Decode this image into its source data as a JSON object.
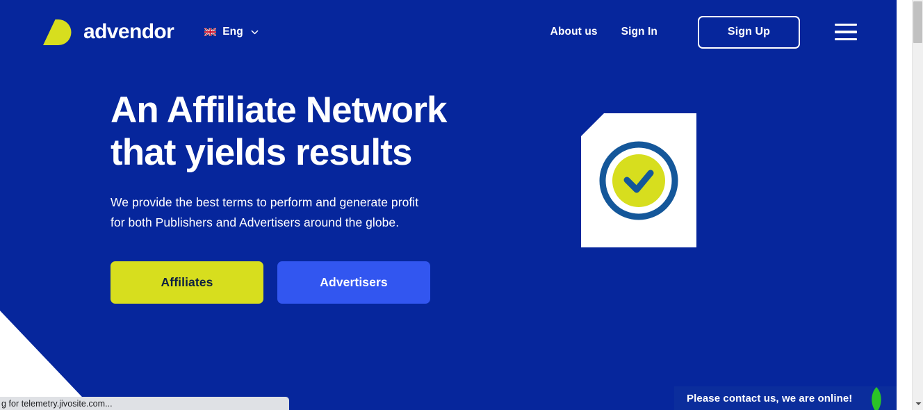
{
  "theme": {
    "page_bg": "#06269c",
    "accent_yellow": "#d7de1e",
    "accent_blue": "#3256f0",
    "ring_blue": "#14579a",
    "text_on_yellow": "#0d2040",
    "white": "#ffffff",
    "chat_bg": "#0b2d9c",
    "chat_leaf_green": "#2bc328"
  },
  "header": {
    "brand_name": "advendor",
    "logo_icon": "advendor-logo-icon",
    "language": {
      "flag_icon": "uk-flag-icon",
      "label": "Eng",
      "chevron_icon": "chevron-down-icon"
    },
    "nav": [
      {
        "label": "About us",
        "name": "nav-link-about-us"
      },
      {
        "label": "Sign In",
        "name": "nav-link-sign-in"
      }
    ],
    "signup_label": "Sign Up",
    "menu_icon": "hamburger-menu-icon"
  },
  "hero": {
    "title_line_1": "An Affiliate Network",
    "title_line_2": "that yields results",
    "subtitle_line_1": "We provide the best terms to perform and generate profit",
    "subtitle_line_2": "for both Publishers and Advertisers around the globe.",
    "buttons": [
      {
        "label": "Affiliates",
        "name": "affiliates-button"
      },
      {
        "label": "Advertisers",
        "name": "advertisers-button"
      }
    ],
    "illustration_icon": "document-with-check-circle-icon"
  },
  "chat_widget": {
    "message": "Please contact us, we are online!",
    "leaf_icon": "jivo-leaf-icon"
  },
  "browser": {
    "status_text": "g for telemetry.jivosite.com...",
    "scroll_down_icon": "scroll-down-arrow-icon"
  }
}
